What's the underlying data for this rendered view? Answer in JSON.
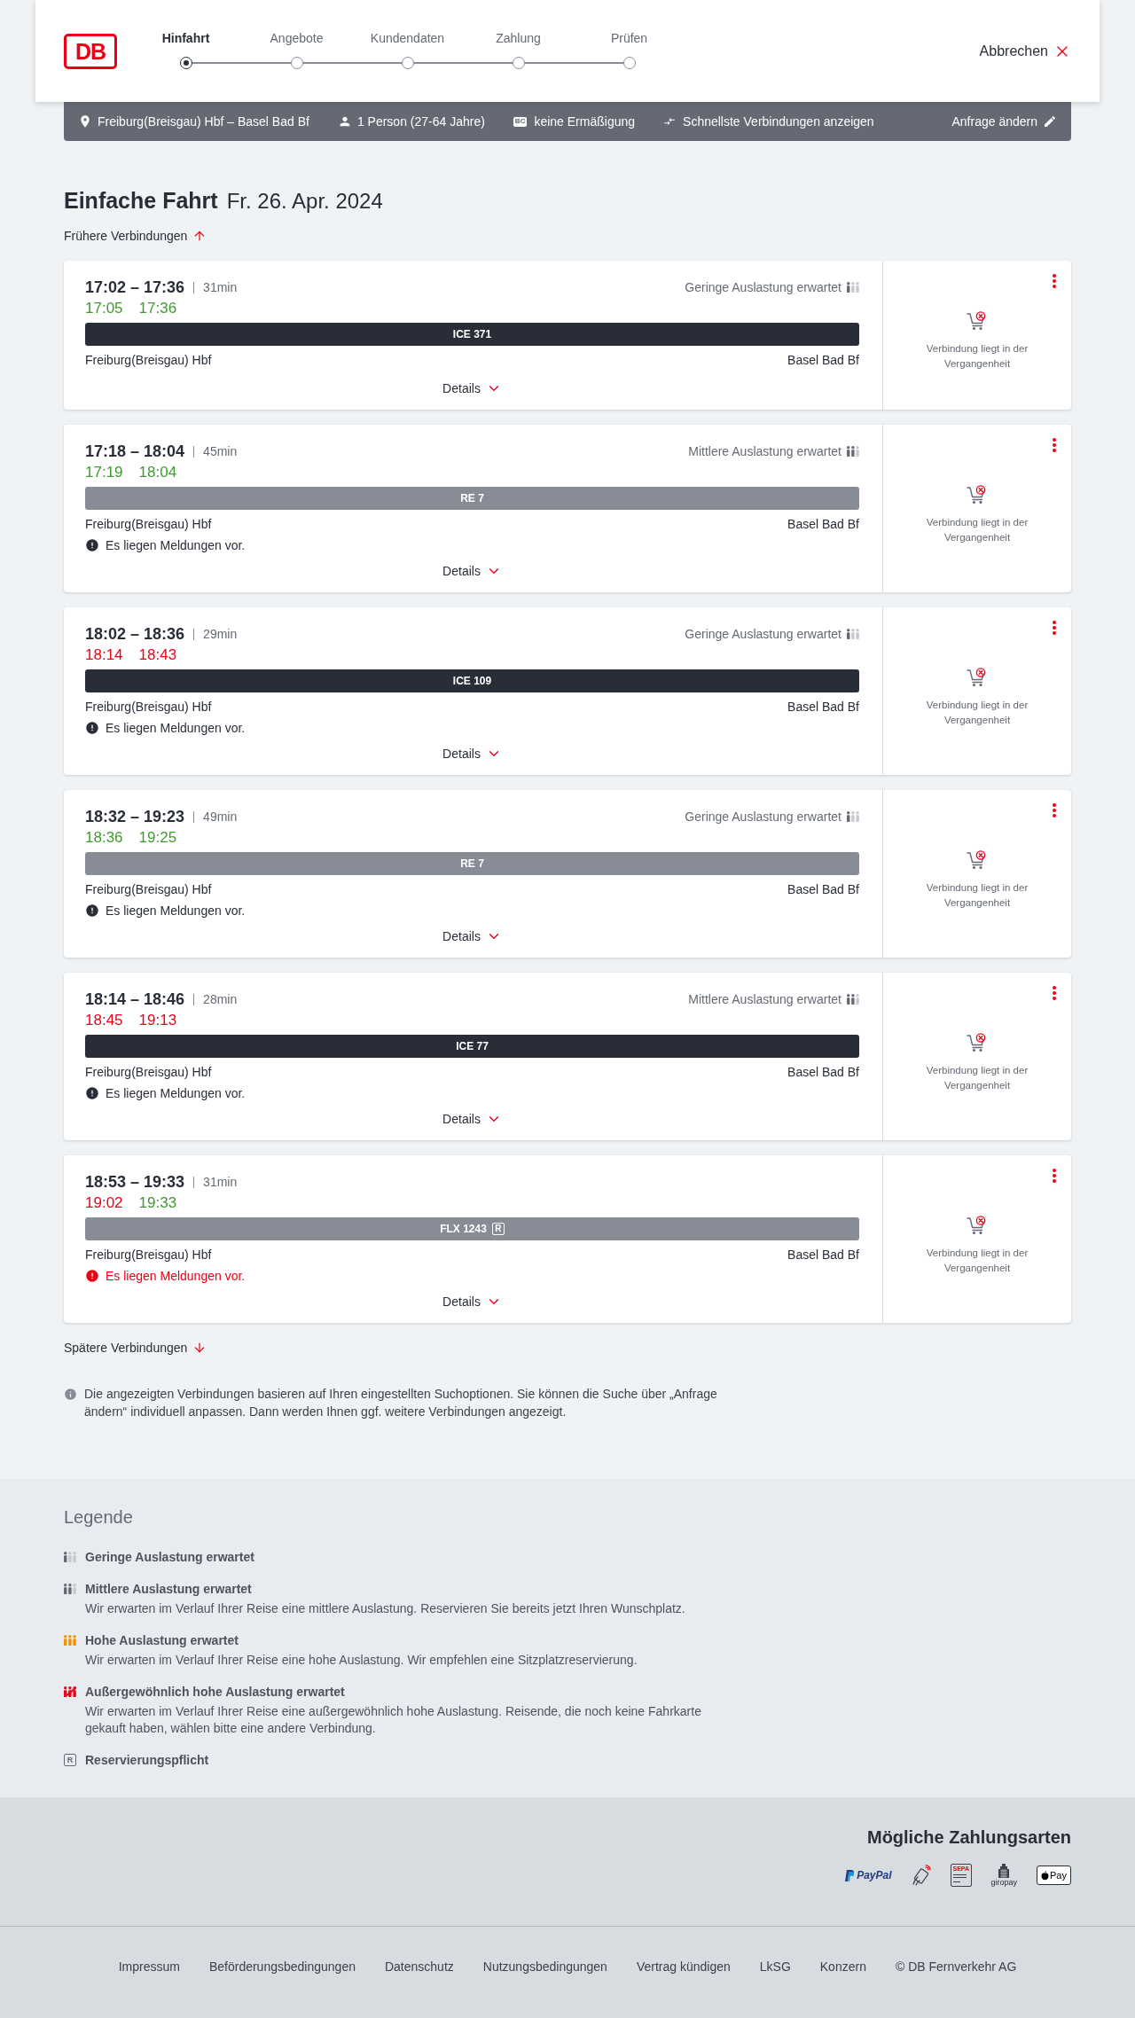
{
  "header": {
    "logo": "DB",
    "steps": [
      {
        "label": "Hinfahrt",
        "selected": true
      },
      {
        "label": "Angebote",
        "selected": false
      },
      {
        "label": "Kundendaten",
        "selected": false
      },
      {
        "label": "Zahlung",
        "selected": false
      },
      {
        "label": "Prüfen",
        "selected": false
      }
    ],
    "cancel": "Abbrechen"
  },
  "search_summary": {
    "route": "Freiburg(Breisgau) Hbf – Basel Bad Bf",
    "passengers": "1 Person (27-64 Jahre)",
    "card_badge": "BC",
    "discount": "keine Ermäßigung",
    "option": "Schnellste Verbindungen anzeigen",
    "edit": "Anfrage ändern"
  },
  "journey": {
    "type": "Einfache Fahrt",
    "date": "Fr. 26. Apr. 2024"
  },
  "earlier_link": "Frühere Verbindungen",
  "connections": [
    {
      "times": "17:02 – 17:36",
      "duration": "31min",
      "realtime": [
        {
          "time": "17:05",
          "delayed": false
        },
        {
          "time": "17:36",
          "delayed": false
        }
      ],
      "occupancy": {
        "label": "Geringe Auslastung erwartet",
        "kind": "low"
      },
      "train": {
        "name": "ICE 371",
        "kind": "ice"
      },
      "from": "Freiburg(Breisgau) Hbf",
      "to": "Basel Bad Bf",
      "details": "Details",
      "status": "Verbindung liegt in der Vergangenheit"
    },
    {
      "times": "17:18 – 18:04",
      "duration": "45min",
      "realtime": [
        {
          "time": "17:19",
          "delayed": false
        },
        {
          "time": "18:04",
          "delayed": false
        }
      ],
      "occupancy": {
        "label": "Mittlere Auslastung erwartet",
        "kind": "medium"
      },
      "train": {
        "name": "RE 7",
        "kind": "other"
      },
      "from": "Freiburg(Breisgau) Hbf",
      "to": "Basel Bad Bf",
      "notice": {
        "text": "Es liegen Meldungen vor.",
        "kind": "info"
      },
      "details": "Details",
      "status": "Verbindung liegt in der Vergangenheit"
    },
    {
      "times": "18:02 – 18:36",
      "duration": "29min",
      "realtime": [
        {
          "time": "18:14",
          "delayed": true
        },
        {
          "time": "18:43",
          "delayed": true
        }
      ],
      "occupancy": {
        "label": "Geringe Auslastung erwartet",
        "kind": "low"
      },
      "train": {
        "name": "ICE 109",
        "kind": "ice"
      },
      "from": "Freiburg(Breisgau) Hbf",
      "to": "Basel Bad Bf",
      "notice": {
        "text": "Es liegen Meldungen vor.",
        "kind": "info"
      },
      "details": "Details",
      "status": "Verbindung liegt in der Vergangenheit"
    },
    {
      "times": "18:32 – 19:23",
      "duration": "49min",
      "realtime": [
        {
          "time": "18:36",
          "delayed": false
        },
        {
          "time": "19:25",
          "delayed": false
        }
      ],
      "occupancy": {
        "label": "Geringe Auslastung erwartet",
        "kind": "low"
      },
      "train": {
        "name": "RE 7",
        "kind": "other"
      },
      "from": "Freiburg(Breisgau) Hbf",
      "to": "Basel Bad Bf",
      "notice": {
        "text": "Es liegen Meldungen vor.",
        "kind": "info"
      },
      "details": "Details",
      "status": "Verbindung liegt in der Vergangenheit"
    },
    {
      "times": "18:14 – 18:46",
      "duration": "28min",
      "realtime": [
        {
          "time": "18:45",
          "delayed": true
        },
        {
          "time": "19:13",
          "delayed": true
        }
      ],
      "occupancy": {
        "label": "Mittlere Auslastung erwartet",
        "kind": "medium"
      },
      "train": {
        "name": "ICE 77",
        "kind": "ice"
      },
      "from": "Freiburg(Breisgau) Hbf",
      "to": "Basel Bad Bf",
      "notice": {
        "text": "Es liegen Meldungen vor.",
        "kind": "info"
      },
      "details": "Details",
      "status": "Verbindung liegt in der Vergangenheit"
    },
    {
      "times": "18:53 – 19:33",
      "duration": "31min",
      "realtime": [
        {
          "time": "19:02",
          "delayed": true
        },
        {
          "time": "19:33",
          "delayed": false
        }
      ],
      "train": {
        "name": "FLX 1243",
        "kind": "other",
        "badge": "R"
      },
      "from": "Freiburg(Breisgau) Hbf",
      "to": "Basel Bad Bf",
      "notice": {
        "text": "Es liegen Meldungen vor.",
        "kind": "alert"
      },
      "details": "Details",
      "status": "Verbindung liegt in der Vergangenheit"
    }
  ],
  "later_link": "Spätere Verbindungen",
  "info_note": "Die angezeigten Verbindungen basieren auf Ihren eingestellten Suchoptionen. Sie können die Suche über „Anfrage ändern“ individuell anpassen. Dann werden Ihnen ggf. weitere Verbindungen angezeigt.",
  "legend": {
    "title": "Legende",
    "items": [
      {
        "kind": "low",
        "title": "Geringe Auslastung erwartet"
      },
      {
        "kind": "medium",
        "title": "Mittlere Auslastung erwartet",
        "description": "Wir erwarten im Verlauf Ihrer Reise eine mittlere Auslastung. Reservieren Sie bereits jetzt Ihren Wunschplatz."
      },
      {
        "kind": "high",
        "title": "Hohe Auslastung erwartet",
        "description": "Wir erwarten im Verlauf Ihrer Reise eine hohe Auslastung. Wir empfehlen eine Sitzplatzreservierung."
      },
      {
        "kind": "exceptional",
        "title": "Außergewöhnlich hohe Auslastung erwartet",
        "description": "Wir erwarten im Verlauf Ihrer Reise eine außergewöhnlich hohe Auslastung. Reisende, die noch keine Fahrkarte gekauft haben, wählen bitte eine andere Verbindung."
      },
      {
        "kind": "reservation",
        "badge": "R",
        "title": "Reservierungspflicht"
      }
    ]
  },
  "payment": {
    "title": "Mögliche Zahlungsarten",
    "methods": [
      {
        "kind": "paypal",
        "label": "PayPal"
      },
      {
        "kind": "contactless"
      },
      {
        "kind": "sepa",
        "label": "SEPA"
      },
      {
        "kind": "giropay",
        "label": "giropay"
      },
      {
        "kind": "applepay",
        "label": "Pay"
      }
    ]
  },
  "footer": {
    "links": [
      "Impressum",
      "Beförderungsbedingungen",
      "Datenschutz",
      "Nutzungsbedingungen",
      "Vertrag kündigen",
      "LkSG",
      "Konzern",
      "© DB Fernverkehr AG"
    ]
  }
}
